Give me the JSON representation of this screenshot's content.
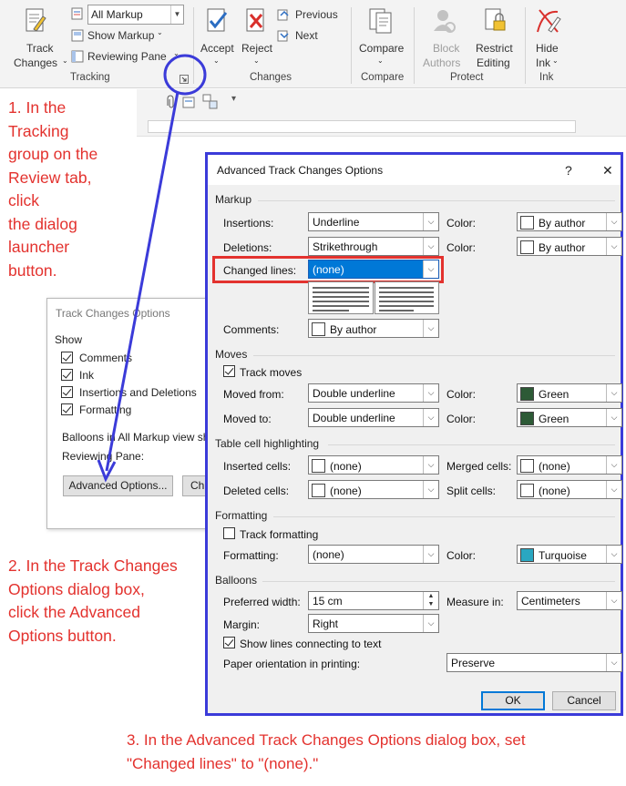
{
  "ribbon": {
    "tracking": {
      "track_changes_line1": "Track",
      "track_changes_line2": "Changes",
      "markup_dropdown": "All Markup",
      "show_markup": "Show Markup",
      "reviewing_pane": "Reviewing Pane",
      "group_label": "Tracking"
    },
    "changes": {
      "accept": "Accept",
      "reject": "Reject",
      "previous": "Previous",
      "next": "Next",
      "group_label": "Changes"
    },
    "compare": {
      "compare": "Compare",
      "group_label": "Compare"
    },
    "protect": {
      "block_line1": "Block",
      "block_line2": "Authors",
      "restrict_line1": "Restrict",
      "restrict_line2": "Editing",
      "group_label": "Protect"
    },
    "ink": {
      "hide_line1": "Hide",
      "hide_line2": "Ink",
      "group_label": "Ink"
    }
  },
  "annotations": {
    "step1": [
      "1. In the",
      "Tracking",
      "group on the",
      "Review tab,",
      "click",
      "the dialog",
      "launcher",
      "button."
    ],
    "step2": [
      "2. In the Track Changes",
      "Options dialog box,",
      "click the Advanced",
      "Options button."
    ],
    "step3": [
      "3. In the Advanced Track Changes Options dialog box, set",
      "\"Changed lines\" to \"(none).\""
    ]
  },
  "track_changes_dialog": {
    "title": "Track Changes Options",
    "show_label": "Show",
    "items": [
      {
        "label": "Comments",
        "checked": true
      },
      {
        "label": "Ink",
        "checked": true
      },
      {
        "label": "Insertions and Deletions",
        "checked": true
      },
      {
        "label": "Formatting",
        "checked": true
      }
    ],
    "balloons_label": "Balloons in All Markup view sh",
    "reviewing_pane_label": "Reviewing Pane:",
    "advanced_button": "Advanced Options...",
    "change_button_partial": "Ch"
  },
  "advanced_dialog": {
    "title": "Advanced Track Changes Options",
    "help": "?",
    "close": "✕",
    "markup": {
      "section": "Markup",
      "insertions_label": "Insertions:",
      "insertions_value": "Underline",
      "insertions_color": "By author",
      "deletions_label": "Deletions:",
      "deletions_value": "Strikethrough",
      "deletions_color": "By author",
      "changed_lines_label": "Changed lines:",
      "changed_lines_value": "(none)",
      "comments_label": "Comments:",
      "comments_value": "By author",
      "color_label": "Color:"
    },
    "moves": {
      "section": "Moves",
      "track_moves": "Track moves",
      "track_moves_checked": true,
      "moved_from_label": "Moved from:",
      "moved_from_value": "Double underline",
      "moved_from_color": "Green",
      "moved_to_label": "Moved to:",
      "moved_to_value": "Double underline",
      "moved_to_color": "Green"
    },
    "table": {
      "section": "Table cell highlighting",
      "inserted_label": "Inserted cells:",
      "inserted_value": "(none)",
      "merged_label": "Merged cells:",
      "merged_value": "(none)",
      "deleted_label": "Deleted cells:",
      "deleted_value": "(none)",
      "split_label": "Split cells:",
      "split_value": "(none)"
    },
    "formatting": {
      "section": "Formatting",
      "track_formatting": "Track formatting",
      "track_formatting_checked": false,
      "formatting_label": "Formatting:",
      "formatting_value": "(none)",
      "color_value": "Turquoise"
    },
    "balloons": {
      "section": "Balloons",
      "preferred_width_label": "Preferred width:",
      "preferred_width_value": "15 cm",
      "measure_in_label": "Measure in:",
      "measure_in_value": "Centimeters",
      "margin_label": "Margin:",
      "margin_value": "Right",
      "show_lines": "Show lines connecting to text",
      "show_lines_checked": true,
      "paper_orientation_label": "Paper orientation in printing:",
      "paper_orientation_value": "Preserve"
    },
    "ok": "OK",
    "cancel": "Cancel"
  },
  "colors": {
    "annotation": "#e3322e",
    "highlight_box": "#3b3bd9",
    "selection": "#0078d7",
    "green": "#2d5a36",
    "turquoise": "#2aa7c1"
  }
}
